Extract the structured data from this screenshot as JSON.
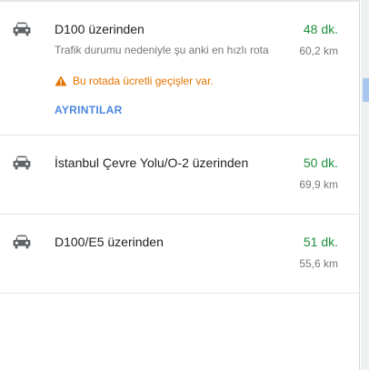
{
  "routes": [
    {
      "name": "D100 üzerinden",
      "time": "48 dk.",
      "distance": "60,2 km",
      "description": "Trafik durumu nedeniyle şu anki en hızlı rota",
      "warning": "Bu rotada ücretli geçişler var.",
      "details_label": "AYRINTILAR",
      "icon": "car-icon"
    },
    {
      "name": "İstanbul Çevre Yolu/O-2 üzerinden",
      "time": "50 dk.",
      "distance": "69,9 km",
      "icon": "car-icon"
    },
    {
      "name": "D100/E5 üzerinden",
      "time": "51 dk.",
      "distance": "55,6 km",
      "icon": "car-icon"
    }
  ],
  "colors": {
    "time": "#1e8e3e",
    "warning": "#e37400",
    "link": "#4a86e0"
  }
}
